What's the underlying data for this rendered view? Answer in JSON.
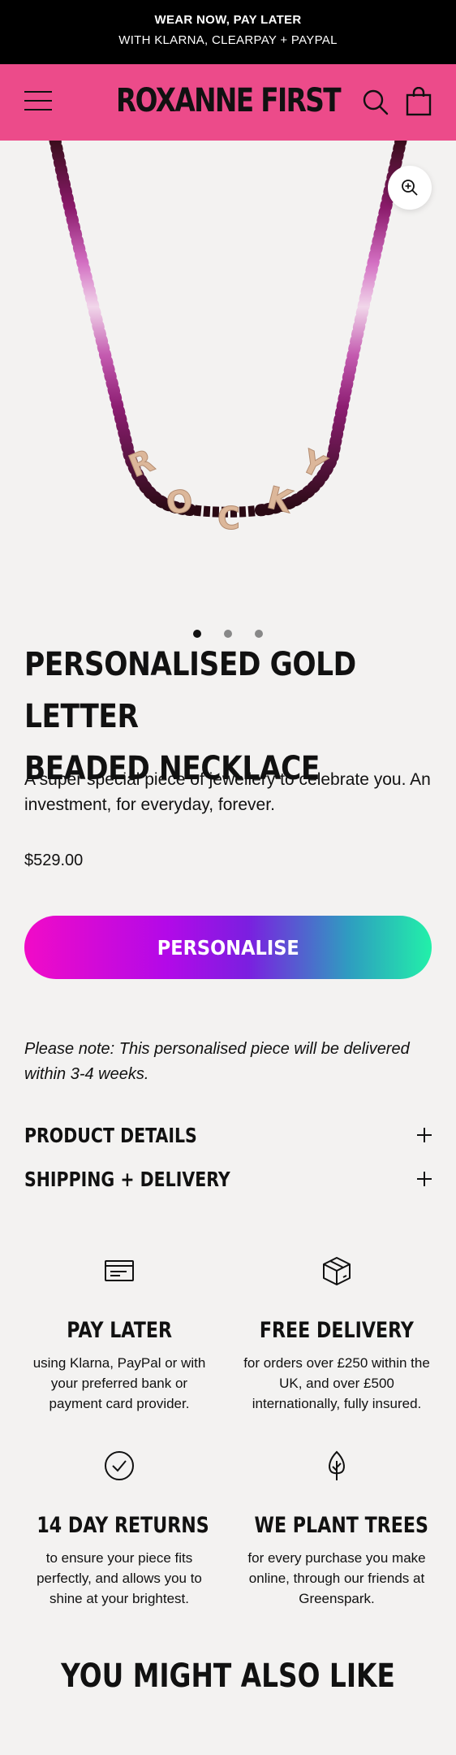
{
  "announcement": {
    "line1": "WEAR NOW, PAY LATER",
    "line2": "WITH KLARNA, CLEARPAY + PAYPAL"
  },
  "header": {
    "logo": "ROXANNE FIRST",
    "bg_color": "#ec4b8a"
  },
  "gallery": {
    "letters": [
      "R",
      "O",
      "C",
      "K",
      "Y"
    ],
    "slide_count": 3,
    "active_slide": 1
  },
  "product": {
    "title_line1": "PERSONALISED GOLD LETTER",
    "title_line2": "BEADED NECKLACE",
    "description": "A super special piece of jewellery to celebrate you. An investment, for everyday, forever.",
    "price": "$529.00",
    "cta_label": "PERSONALISE",
    "note": "Please note: This personalised piece will be delivered within 3-4 weeks."
  },
  "accordions": [
    {
      "label": "PRODUCT DETAILS"
    },
    {
      "label": "SHIPPING + DELIVERY"
    }
  ],
  "features": [
    {
      "icon": "card-icon",
      "title": "PAY LATER",
      "text": "using Klarna, PayPal or with your preferred bank or payment card provider."
    },
    {
      "icon": "box-icon",
      "title": "FREE DELIVERY",
      "text": "for orders over £250 within the UK, and over £500 internationally, fully insured."
    },
    {
      "icon": "check-circle-icon",
      "title": "14 DAY RETURNS",
      "text": "to ensure your piece fits perfectly, and allows you to shine at your brightest."
    },
    {
      "icon": "tree-icon",
      "title": "WE PLANT TREES",
      "text": "for every purchase you make online, through our friends at Greenspark."
    }
  ],
  "also_like": {
    "heading": "YOU MIGHT ALSO LIKE"
  }
}
